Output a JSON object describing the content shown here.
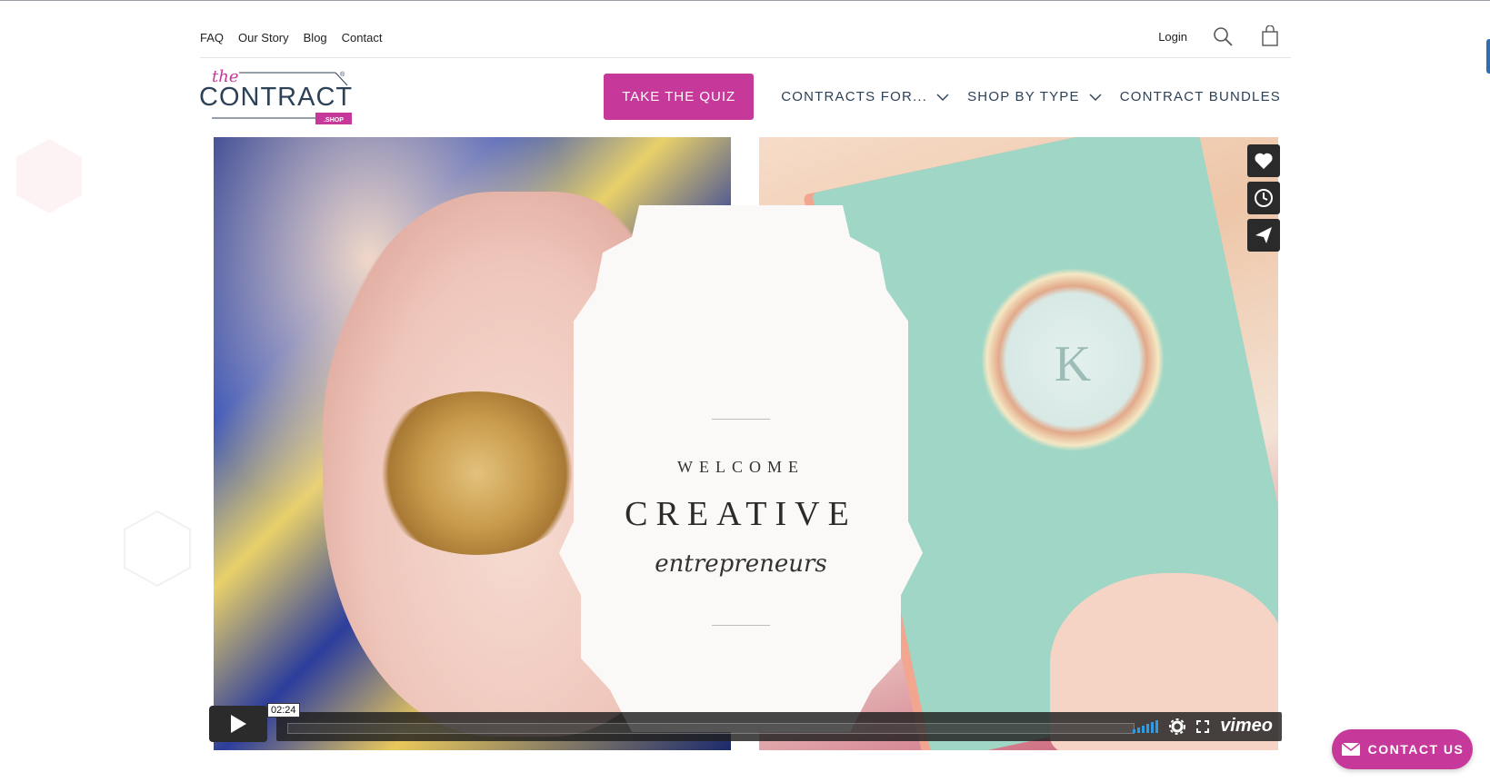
{
  "utility_nav": {
    "links": [
      "FAQ",
      "Our Story",
      "Blog",
      "Contact"
    ],
    "login": "Login"
  },
  "brand": {
    "logo_the": "the",
    "logo_main": "CONTRACT",
    "logo_tag": ".SHOP",
    "registered": "®",
    "accent_color": "#c6399a",
    "navy_color": "#2d4157"
  },
  "main_nav": {
    "quiz_button": "TAKE THE QUIZ",
    "contracts_for": "CONTRACTS FOR...",
    "shop_by_type": "SHOP BY TYPE",
    "bundles": "CONTRACT BUNDLES"
  },
  "hero": {
    "welcome": "WELCOME",
    "creative": "CREATIVE",
    "entrepreneurs": "entrepreneurs",
    "book_monogram": "K"
  },
  "video_player": {
    "time": "02:24",
    "provider": "vimeo",
    "side_tools": [
      "heart-icon",
      "clock-icon",
      "send-icon"
    ]
  },
  "contact_widget": {
    "label": "CONTACT US"
  }
}
